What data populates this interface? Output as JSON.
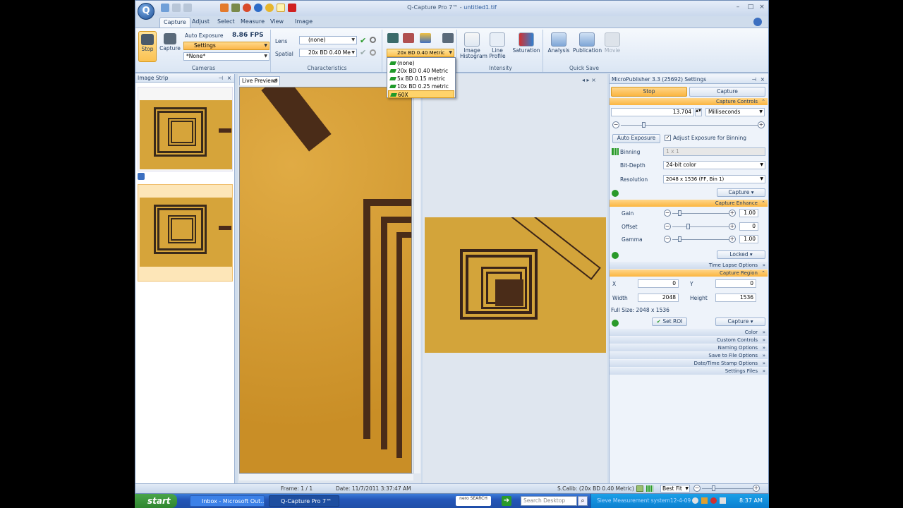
{
  "window": {
    "app_title": "Q-Capture Pro 7™",
    "title_sep": " - ",
    "file_name": "untitled1.tif"
  },
  "tabs": [
    "Capture",
    "Adjust",
    "Select",
    "Measure",
    "View",
    "Image"
  ],
  "ribbon": {
    "cameras": {
      "stop": "Stop",
      "capture": "Capture",
      "auto_exposure": "Auto Exposure",
      "fps": "8.86 FPS",
      "settings": "Settings",
      "preset": "*None*",
      "label": "Cameras"
    },
    "characteristics": {
      "lens_label": "Lens",
      "lens_value": "(none)",
      "spatial_label": "Spatial",
      "spatial_value": "20x BD 0.40 Me",
      "label": "Characteristics"
    },
    "calibration_selected": "20x BD 0.40 Metric",
    "intensity": {
      "histogram": "Image Histogram",
      "line_profile": "Line Profile",
      "saturation": "Saturation",
      "label": "Intensity"
    },
    "quick_save": {
      "analysis": "Analysis",
      "publication": "Publication",
      "movie": "Movie",
      "label": "Quick Save"
    }
  },
  "dropdown": {
    "items": [
      "(none)",
      "20x BD 0.40 Metric",
      "5x BD 0.15 metric",
      "10x BD 0.25 metric",
      "60X"
    ],
    "selected_index": 4
  },
  "image_strip": {
    "title": "Image Strip"
  },
  "live_preview": {
    "tab": "Live Preview*"
  },
  "status": {
    "frame": "Frame: 1 / 1",
    "date": "Date: 11/7/2011 3:37:47 AM",
    "calib": "S.Calib: (20x BD 0.40 Metric)",
    "fit": "Best Fit"
  },
  "settings": {
    "title": "MicroPublisher 3.3 (25692) Settings",
    "stop_tab": "Stop",
    "capture_tab": "Capture",
    "capture_controls": "Capture Controls",
    "exposure_value": "13.704",
    "exposure_unit": "Milliseconds",
    "auto_exposure": "Auto Exposure",
    "adjust_binning": "Adjust Exposure for Binning",
    "binning_label": "Binning",
    "binning_value": "1 x 1",
    "bitdepth_label": "Bit-Depth",
    "bitdepth_value": "24-bit color",
    "resolution_label": "Resolution",
    "resolution_value": "2048 x 1536 (FF,  Bin 1)",
    "capture_btn": "Capture",
    "capture_enhance": "Capture Enhance",
    "gain_label": "Gain",
    "gain_value": "1.00",
    "offset_label": "Offset",
    "offset_value": "0",
    "gamma_label": "Gamma",
    "gamma_value": "1.00",
    "locked": "Locked",
    "time_lapse": "Time Lapse Options",
    "capture_region": "Capture Region",
    "x_label": "X",
    "x_value": "0",
    "y_label": "Y",
    "y_value": "0",
    "width_label": "Width",
    "width_value": "2048",
    "height_label": "Height",
    "height_value": "1536",
    "full_size": "Full Size: 2048 x 1536",
    "set_roi": "Set ROI",
    "sections": [
      "Color",
      "Custom Controls",
      "Naming Options",
      "Save to File Options",
      "Date/Time Stamp Options",
      "Settings Files"
    ]
  },
  "taskbar": {
    "start": "start",
    "items": [
      "Inbox - Microsoft Out...",
      "Q-Capture Pro 7™"
    ],
    "nero": "nero SEARCH",
    "search": "Search Desktop",
    "notify": "Sieve Measurement system12-4-09",
    "clock": "8:37 AM"
  }
}
